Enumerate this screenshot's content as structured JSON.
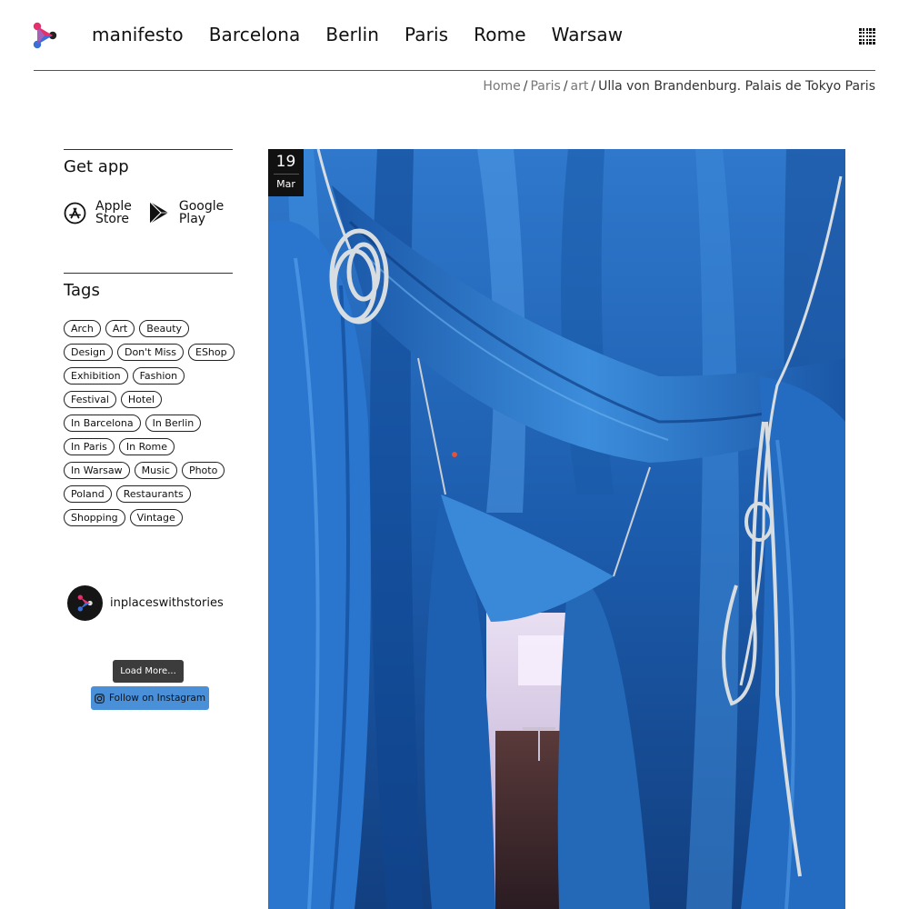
{
  "header": {
    "nav": [
      "manifesto",
      "Barcelona",
      "Berlin",
      "Paris",
      "Rome",
      "Warsaw"
    ],
    "logo_icon": "play-arrow-logo-icon",
    "menu_icon": "grid-menu-icon"
  },
  "breadcrumb": {
    "items": [
      "Home",
      "Paris",
      "art"
    ],
    "current": "Ulla von Brandenburg. Palais de Tokyo Paris"
  },
  "sidebar": {
    "get_app_title": "Get app",
    "apps": [
      {
        "line1": "Apple",
        "line2": "Store",
        "icon": "app-store-icon"
      },
      {
        "line1": "Google",
        "line2": "Play",
        "icon": "google-play-icon"
      }
    ],
    "tags_title": "Tags",
    "tags": [
      "Arch",
      "Art",
      "Beauty",
      "Design",
      "Don't Miss",
      "EShop",
      "Exhibition",
      "Fashion",
      "Festival",
      "Hotel",
      "In Barcelona",
      "In Berlin",
      "In Paris",
      "In Rome",
      "In Warsaw",
      "Music",
      "Photo",
      "Poland",
      "Restaurants",
      "Shopping",
      "Vintage"
    ]
  },
  "instagram": {
    "username": "inplaceswithstories",
    "load_more": "Load More...",
    "follow": "Follow on Instagram"
  },
  "post": {
    "day": "19",
    "month": "Mar"
  },
  "colors": {
    "accent_blue": "#4a90d9",
    "fabric_blue": "#1f5fae",
    "logo_pink": "#e5306b",
    "logo_blue": "#3a6fd8"
  }
}
